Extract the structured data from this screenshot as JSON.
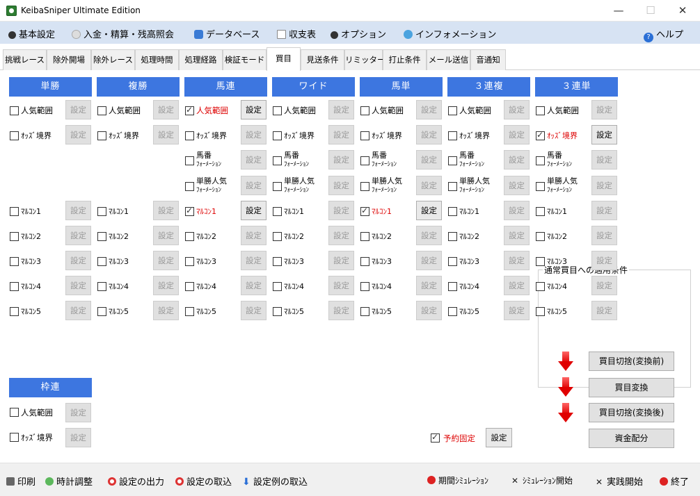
{
  "window": {
    "title": "KeibaSniper Ultimate Edition",
    "min": "—",
    "max": "☐",
    "close": "✕"
  },
  "menu": [
    {
      "label": "基本設定",
      "icon": "gear-icon"
    },
    {
      "label": "入金・精算・残高照会",
      "icon": "coin-icon"
    },
    {
      "label": "データベース",
      "icon": "database-icon"
    },
    {
      "label": "収支表",
      "icon": "document-icon"
    },
    {
      "label": "オプション",
      "icon": "gear-icon"
    },
    {
      "label": "インフォメーション",
      "icon": "info-bubble-icon"
    },
    {
      "label": "ヘルプ",
      "icon": "help-icon"
    }
  ],
  "tabs": [
    "挑戦レース",
    "除外開場",
    "除外レース",
    "処理時間",
    "処理経路",
    "検証モード",
    "買目",
    "見送条件",
    "リミッター",
    "打止条件",
    "メール送信",
    "音通知"
  ],
  "active_tab": "買目",
  "columns": [
    {
      "header": "単勝"
    },
    {
      "header": "複勝"
    },
    {
      "header": "馬連"
    },
    {
      "header": "ワイド"
    },
    {
      "header": "馬単"
    },
    {
      "header": "３連複"
    },
    {
      "header": "３連単"
    }
  ],
  "labels": {
    "ninki": "人気範囲",
    "odds": "ｵｯｽﾞ境界",
    "umaban1": "馬番",
    "umaban2": "ﾌｫｰﾒｰｼｮﾝ",
    "tanninki1": "単勝人気",
    "tanninki2": "ﾌｫｰﾒｰｼｮﾝ",
    "marukon1": "ﾏﾙｺﾝ1",
    "marukon2": "ﾏﾙｺﾝ2",
    "marukon3": "ﾏﾙｺﾝ3",
    "marukon4": "ﾏﾙｺﾝ4",
    "marukon5": "ﾏﾙｺﾝ5",
    "settei": "設定"
  },
  "wakuren": {
    "header": "枠連"
  },
  "yoyaku": {
    "label": "予約固定",
    "button": "設定"
  },
  "apply_group": {
    "title": "通常買目への適用条件",
    "buttons": [
      "買目切捨(変換前)",
      "買目変換",
      "買目切捨(変換後)",
      "資金配分"
    ]
  },
  "footer": {
    "left": [
      {
        "label": "印刷",
        "icon": "printer-icon"
      },
      {
        "label": "時計調整",
        "icon": "clock-icon"
      },
      {
        "label": "設定の出力",
        "icon": "export-icon"
      },
      {
        "label": "設定の取込",
        "icon": "import-icon"
      },
      {
        "label": "設定例の取込",
        "icon": "download-arrow-icon"
      }
    ],
    "right": [
      {
        "label": "期間ｼﾐｭﾚｰｼｮﾝ",
        "icon": "red-ball-icon"
      },
      {
        "label": "ｼﾐｭﾚｰｼｮﾝ開始",
        "icon": "shuffle-icon"
      },
      {
        "label": "実践開始",
        "icon": "shuffle-icon"
      },
      {
        "label": "終了",
        "icon": "exit-icon"
      }
    ]
  }
}
